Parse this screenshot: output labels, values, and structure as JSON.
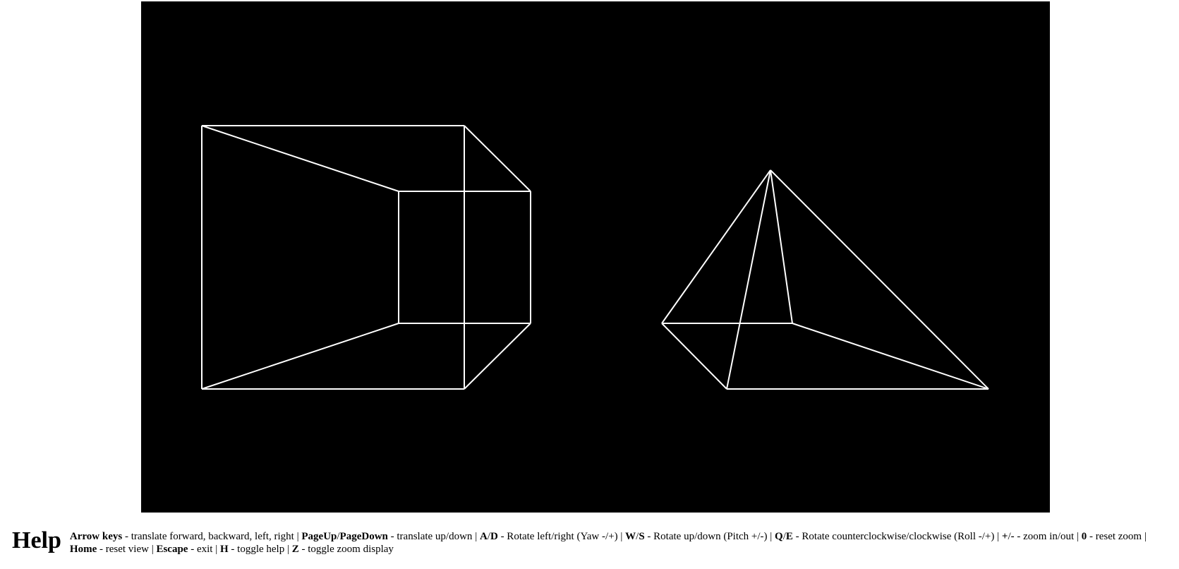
{
  "help": {
    "title": "Help",
    "items": [
      {
        "keys": [
          "Arrow keys"
        ],
        "seps": [],
        "desc": " - translate forward, backward, left, right"
      },
      {
        "keys": [
          "PageUp",
          "PageDown"
        ],
        "seps": [
          "/"
        ],
        "desc": " - translate up/down"
      },
      {
        "keys": [
          "A",
          "D"
        ],
        "seps": [
          "/"
        ],
        "desc": " - Rotate left/right (Yaw -/+)"
      },
      {
        "keys": [
          "W",
          "S"
        ],
        "seps": [
          "/"
        ],
        "desc": " - Rotate up/down (Pitch +/-)"
      },
      {
        "keys": [
          "Q",
          "E"
        ],
        "seps": [
          "/"
        ],
        "desc": " - Rotate counterclockwise/clockwise (Roll -/+)"
      },
      {
        "keys": [
          "+",
          "-"
        ],
        "seps": [
          "/"
        ],
        "desc": " - zoom in/out"
      },
      {
        "keys": [
          "0"
        ],
        "seps": [],
        "desc": " - reset zoom"
      },
      {
        "keys": [
          "Home"
        ],
        "seps": [],
        "desc": " - reset view"
      },
      {
        "keys": [
          "Escape"
        ],
        "seps": [],
        "desc": " - exit"
      },
      {
        "keys": [
          "H"
        ],
        "seps": [],
        "desc": " - toggle help"
      },
      {
        "keys": [
          "Z"
        ],
        "seps": [],
        "desc": " - toggle zoom display"
      }
    ],
    "separator": " | "
  },
  "scene": {
    "background_color": "#000000",
    "line_color": "#ffffff",
    "objects": [
      "wireframe-cube",
      "wireframe-pyramid"
    ]
  }
}
